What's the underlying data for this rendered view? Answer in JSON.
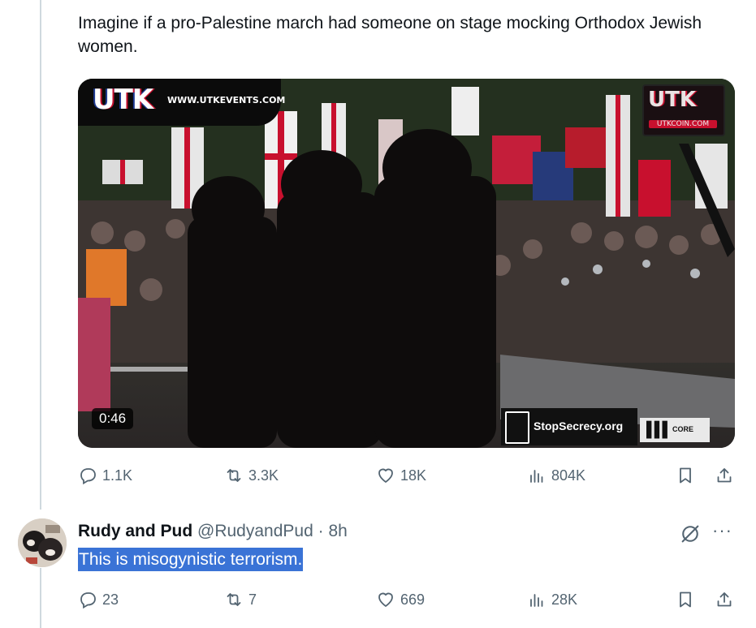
{
  "post1": {
    "text": "Imagine if a pro-Palestine march had someone on stage mocking Orthodox Jewish women.",
    "media": {
      "duration": "0:46",
      "watermark_left_logo": "UTK",
      "watermark_left_url": "WWW.UTKEVENTS.COM",
      "watermark_right_logo": "UTK",
      "watermark_right_sub": "UTKCOIN.COM",
      "badge_stop": "StopSecrecy.org",
      "badge_core": "CORE"
    },
    "actions": {
      "replies": "1.1K",
      "reposts": "3.3K",
      "likes": "18K",
      "views": "804K"
    }
  },
  "reply": {
    "name": "Rudy and Pud",
    "handle": "@RudyandPud",
    "separator": "·",
    "time": "8h",
    "text": "This is misogynistic terrorism.",
    "more_label": "···",
    "actions": {
      "replies": "23",
      "reposts": "7",
      "likes": "669",
      "views": "28K"
    }
  },
  "colors": {
    "text": "#0f1419",
    "muted": "#536471",
    "selection": "#3a73d6",
    "thread_line": "#cfd9de"
  },
  "icons": [
    "reply-icon",
    "repost-icon",
    "like-icon",
    "views-icon",
    "bookmark-icon",
    "share-icon",
    "grok-icon",
    "more-icon"
  ]
}
